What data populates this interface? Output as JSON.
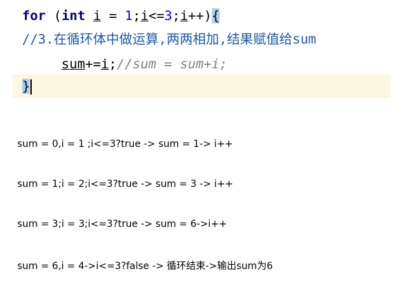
{
  "code": {
    "line1": {
      "kw_for": "for",
      "paren_open": " (",
      "kw_int": "int",
      "space": " ",
      "var_i": "i",
      "eq": " = ",
      "num1": "1",
      "semi1": ";",
      "var_i2": "i",
      "lte": "<=",
      "num3": "3",
      "semi2": ";",
      "var_i3": "i",
      "inc": "++)",
      "brace": "{"
    },
    "line2": {
      "comment": "//3.在循环体中做运算,两两相加,结果赋值给sum"
    },
    "line3": {
      "var_sum": "sum",
      "op": "+=",
      "var_i": "i",
      "semi": ";",
      "comment": "//sum = sum+i;"
    },
    "line4": {
      "brace": "}"
    }
  },
  "explanation": [
    "sum = 0,i = 1 ;i<=3?true -> sum = 1-> i++",
    "sum = 1;i = 2;i<=3?true -> sum = 3 -> i++",
    "sum = 3;i = 3;i<=3?true -> sum = 6->i++",
    "sum = 6,i = 4->i<=3?false -> 循环结束->输出sum为6"
  ]
}
